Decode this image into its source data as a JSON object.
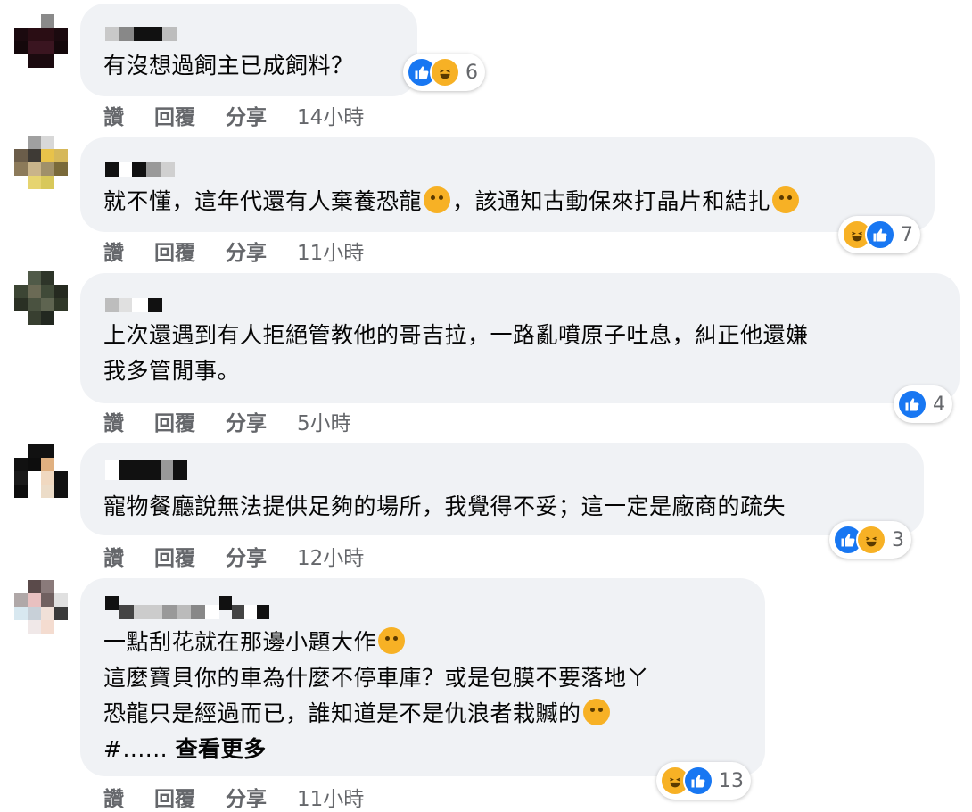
{
  "action_labels": {
    "like": "讚",
    "reply": "回覆",
    "share": "分享"
  },
  "comments": [
    {
      "text_lines": [
        "有沒想過飼主已成飼料？"
      ],
      "reaction_count": "6",
      "reactions": [
        "like-icon",
        "haha-icon"
      ],
      "time": "14小時"
    },
    {
      "text_lines": [
        "就不懂，這年代還有人棄養恐龍",
        "，該通知古動保來打晶片和結扎"
      ],
      "reaction_count": "7",
      "reactions": [
        "haha-icon",
        "like-icon"
      ],
      "time": "11小時"
    },
    {
      "text_lines": [
        "上次還遇到有人拒絕管教他的哥吉拉，一路亂噴原子吐息，糾正他還嫌",
        "我多管閒事。"
      ],
      "reaction_count": "4",
      "reactions": [
        "like-icon"
      ],
      "time": "5小時"
    },
    {
      "text_lines": [
        "寵物餐廳說無法提供足夠的場所，我覺得不妥；這一定是廠商的疏失"
      ],
      "reaction_count": "3",
      "reactions": [
        "like-icon",
        "haha-icon"
      ],
      "time": "12小時"
    },
    {
      "text_lines": [
        "一點刮花就在那邊小題大作",
        "這麼寶貝你的車為什麼不停車庫？或是包膜不要落地ㄚ",
        "恐龍只是經過而已，誰知道是不是仇浪者栽贓的",
        "#......"
      ],
      "see_more": "查看更多",
      "reaction_count": "13",
      "reactions": [
        "haha-icon",
        "like-icon"
      ],
      "time": "11小時"
    }
  ],
  "colors": {
    "like": "#1877f2",
    "haha": "#f7b125",
    "bubble": "#f0f2f5",
    "meta": "#65676b"
  }
}
